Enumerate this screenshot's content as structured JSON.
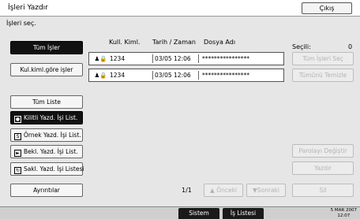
{
  "window": {
    "title": "İşleri Yazdır",
    "exit_label": "Çıkış"
  },
  "select_jobs": {
    "label": "İşleri seç."
  },
  "filters": {
    "all_jobs": "Tüm İşler",
    "by_user_id": "Kul.kiml.göre işler"
  },
  "columns": {
    "user_id": "Kull. Kiml.",
    "date_time": "Tarih / Zaman",
    "file_name": "Dosya Adı"
  },
  "jobs": [
    {
      "user_id": "1234",
      "date_time": "03/05 12:06",
      "file_name": "****************"
    },
    {
      "user_id": "1234",
      "date_time": "03/05 12:06",
      "file_name": "****************"
    }
  ],
  "lists": {
    "all_list": "Tüm Liste",
    "locked": "Kilitli Yazd. İşi List.",
    "sample": "Örnek Yazd. İşi List.",
    "hold": "Bekl. Yazd. İşi List.",
    "stored": "Sakl. Yazd. İşi Listesi"
  },
  "selected": {
    "label": "Seçili:",
    "count": "0"
  },
  "actions": {
    "select_all": "Tüm İşleri Seç",
    "clear_all": "Tümünü Temizle",
    "change_password": "Parolayı Değiştir",
    "print": "Yazdır",
    "delete": "Sil"
  },
  "footer": {
    "details": "Ayrıntılar",
    "page": "1/1",
    "previous": "Önceki",
    "next": "Sonraki"
  },
  "statusbar": {
    "system_status": "Sistem Durumu",
    "job_list": "İş Listesi",
    "date": "5 MAR  2007",
    "time": "12:07"
  }
}
